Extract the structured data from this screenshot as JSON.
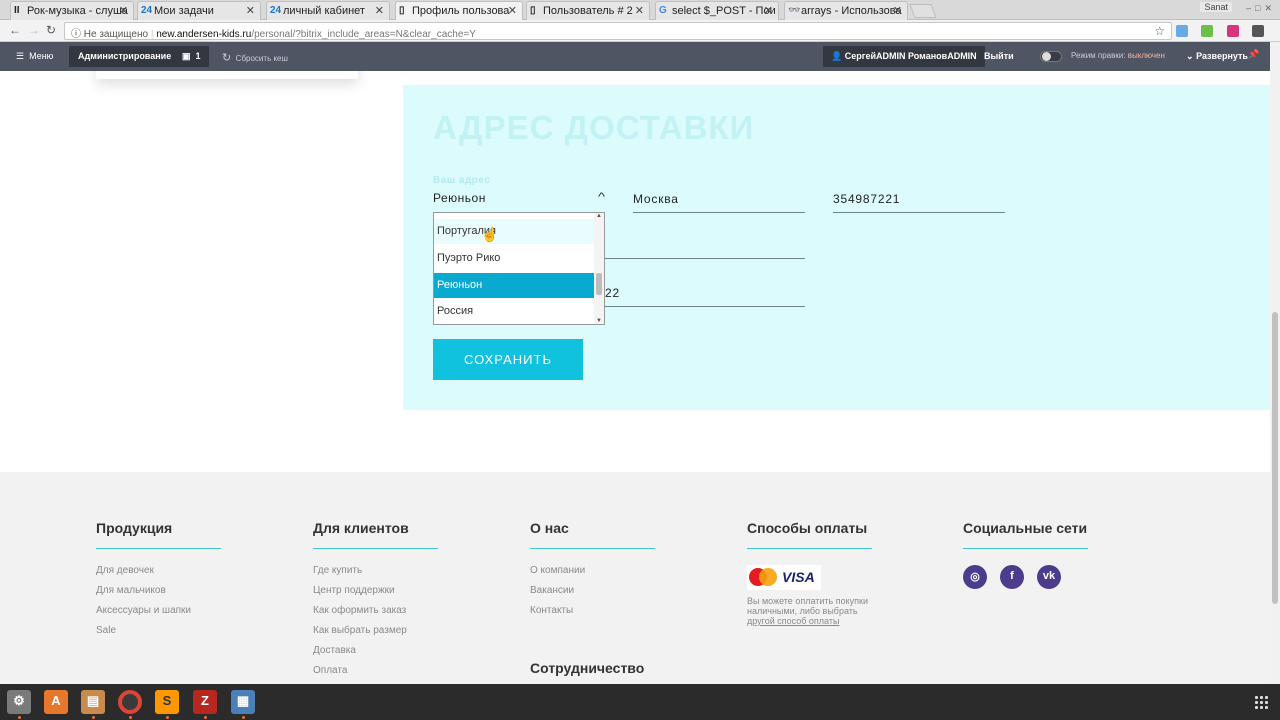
{
  "browser": {
    "tabs": [
      {
        "label": "Рок-музыка - слуша",
        "favicon": "II"
      },
      {
        "label": "Мои задачи",
        "favicon": "24"
      },
      {
        "label": "личный кабинет",
        "favicon": "24"
      },
      {
        "label": "Профиль пользова",
        "favicon": "▯"
      },
      {
        "label": "Пользователь # 2",
        "favicon": "▯"
      },
      {
        "label": "select $_POST - Пои",
        "favicon": "G"
      },
      {
        "label": "arrays - Использова",
        "favicon": "👓"
      }
    ],
    "window_user": "Sanat",
    "security": "Не защищено",
    "url_domain": "new.andersen-kids.ru",
    "url_path": "/personal/?bitrix_include_areas=N&clear_cache=Y"
  },
  "adminbar": {
    "menu": "Меню",
    "admin": "Администрирование",
    "notif_count": "1",
    "reset_cache": "Сбросить кеш",
    "user": "СергейADMIN РомановADMIN",
    "logout": "Выйти",
    "edit_mode": "Режим правки:",
    "edit_state": "выключен",
    "expand": "Развернуть"
  },
  "delivery": {
    "title": "АДРЕС ДОСТАВКИ",
    "address_label": "Ваш адрес",
    "country_value": "Реюньон",
    "city_value": "Москва",
    "zip_value": "354987221",
    "partial_value": "22",
    "save_label": "СОХРАНИТЬ",
    "options": [
      "Португалия",
      "Пуэрто Рико",
      "Реюньон",
      "Россия"
    ]
  },
  "footer": {
    "products": {
      "title": "Продукция",
      "links": [
        "Для девочек",
        "Для мальчиков",
        "Аксессуары и шапки",
        "Sale"
      ]
    },
    "clients": {
      "title": "Для клиентов",
      "links": [
        "Где купить",
        "Центр поддержки",
        "Как оформить заказ",
        "Как выбрать размер",
        "Доставка",
        "Оплата"
      ]
    },
    "about": {
      "title": "О нас",
      "links": [
        "О компании",
        "Вакансии",
        "Контакты"
      ],
      "sub": "Сотрудничество"
    },
    "payment": {
      "title": "Способы оплаты",
      "note": "Вы можете оплатить покупки наличными, либо выбрать",
      "note_link": "другой способ оплаты",
      "visa": "VISA"
    },
    "social": {
      "title": "Социальные сети",
      "icons": [
        "instagram-icon",
        "facebook-icon",
        "vk-icon"
      ]
    }
  },
  "colors": {
    "accent": "#10c2de",
    "panel": "#dbfbfd",
    "adminbar": "#505563"
  }
}
